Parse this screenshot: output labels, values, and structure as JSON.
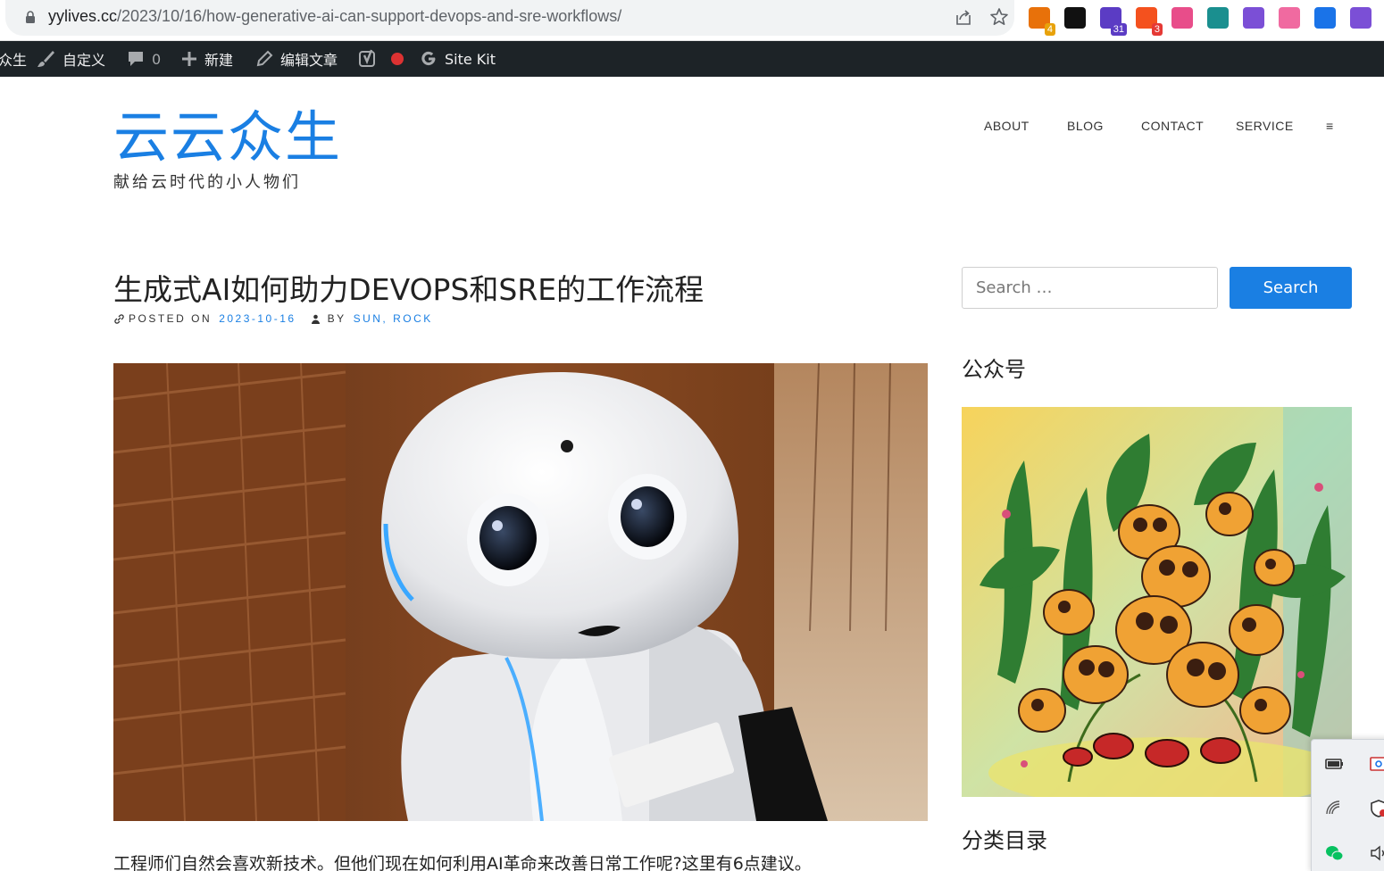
{
  "browser": {
    "url_domain": "yylives.cc",
    "url_path": "/2023/10/16/how-generative-ai-can-support-devops-and-sre-workflows/",
    "extensions": [
      {
        "name": "ext-1",
        "badge": "4",
        "color": "#e8710a",
        "badge_color": "#e8a20a"
      },
      {
        "name": "notion",
        "badge": "",
        "color": "#111111",
        "badge_color": ""
      },
      {
        "name": "ext-3",
        "badge": "31",
        "color": "#5b3cc4",
        "badge_color": "#5b3cc4"
      },
      {
        "name": "ext-4",
        "badge": "3",
        "color": "#f4511e",
        "badge_color": "#e53935"
      },
      {
        "name": "translate",
        "badge": "",
        "color": "#e84d8a",
        "badge_color": ""
      },
      {
        "name": "ext-6",
        "badge": "",
        "color": "#1a8f8f",
        "badge_color": ""
      },
      {
        "name": "ext-7",
        "badge": "",
        "color": "#7b4fd6",
        "badge_color": ""
      },
      {
        "name": "ext-8",
        "badge": "",
        "color": "#f06aa0",
        "badge_color": ""
      },
      {
        "name": "ext-9",
        "badge": "",
        "color": "#1a73e8",
        "badge_color": ""
      },
      {
        "name": "openai",
        "badge": "",
        "color": "#7b4fd6",
        "badge_color": ""
      }
    ]
  },
  "admin_bar": {
    "site_name": "众生",
    "customize": "自定义",
    "comments_count": "0",
    "new": "新建",
    "edit_post": "编辑文章",
    "site_kit": "Site Kit"
  },
  "site": {
    "title": "云云众生",
    "description": "献给云时代的小人物们",
    "nav": [
      "ABOUT",
      "BLOG",
      "CONTACT",
      "SERVICE"
    ],
    "menu_glyph": "≡"
  },
  "post": {
    "title": "生成式AI如何助力DEVOPS和SRE的工作流程",
    "posted_on_label": "POSTED ON",
    "date": "2023-10-16",
    "by_label": "BY",
    "author": "SUN, ROCK",
    "excerpt": "工程师们自然会喜欢新技术。但他们现在如何利用AI革命来改善日常工作呢?这里有6点建议。"
  },
  "sidebar": {
    "search_placeholder": "Search …",
    "search_button": "Search",
    "widget_wechat": "公众号",
    "widget_categories": "分类目录"
  },
  "colors": {
    "accent": "#1a7fe3",
    "admin_bar_bg": "#1d2327"
  }
}
